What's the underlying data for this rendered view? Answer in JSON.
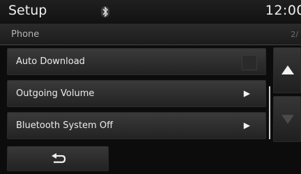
{
  "header": {
    "title": "Setup",
    "bluetooth_icon": "bluetooth-icon",
    "time": "12:00"
  },
  "subheader": {
    "section": "Phone",
    "page_indicator": "2/"
  },
  "menu": {
    "items": [
      {
        "label": "Auto Download",
        "control": "checkbox",
        "checked": false
      },
      {
        "label": "Outgoing Volume",
        "control": "arrow",
        "icon": "play-arrow-icon"
      },
      {
        "label": "Bluetooth System Off",
        "control": "arrow",
        "icon": "play-arrow-icon"
      }
    ]
  },
  "scroll": {
    "up_icon": "triangle-up-icon",
    "down_icon": "triangle-down-icon",
    "down_enabled": false
  },
  "footer": {
    "back_icon": "back-arrow-icon"
  }
}
